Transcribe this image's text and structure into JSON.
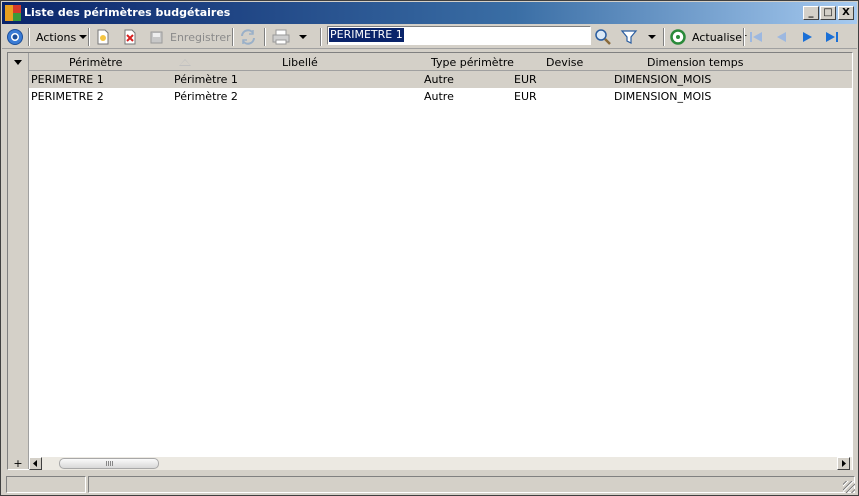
{
  "window": {
    "title": "Liste des périmètres budgétaires",
    "buttons": {
      "minimize": "_",
      "maximize": "□",
      "close": "X"
    }
  },
  "toolbar": {
    "actions_label": "Actions",
    "save_label": "Enregistrer",
    "refresh_label": "Actualiser",
    "search_value": "PERIMETRE 1"
  },
  "grid": {
    "columns": [
      "Périmètre",
      "Libellé",
      "Type périmètre",
      "Devise",
      "Dimension temps"
    ],
    "rows": [
      {
        "perimetre": "PERIMETRE 1",
        "libelle": "Périmètre 1",
        "type": "Autre",
        "devise": "EUR",
        "dimension": "DIMENSION_MOIS"
      },
      {
        "perimetre": "PERIMETRE 2",
        "libelle": "Périmètre 2",
        "type": "Autre",
        "devise": "EUR",
        "dimension": "DIMENSION_MOIS"
      }
    ],
    "selected_row": 0,
    "add_label": "+"
  },
  "colors": {
    "title_gradient_start": "#0a246a",
    "title_gradient_end": "#a6caf0",
    "window_bg": "#d4d0c8",
    "nav_disabled": "#9db8e0",
    "nav_enabled": "#1a6fd6"
  }
}
